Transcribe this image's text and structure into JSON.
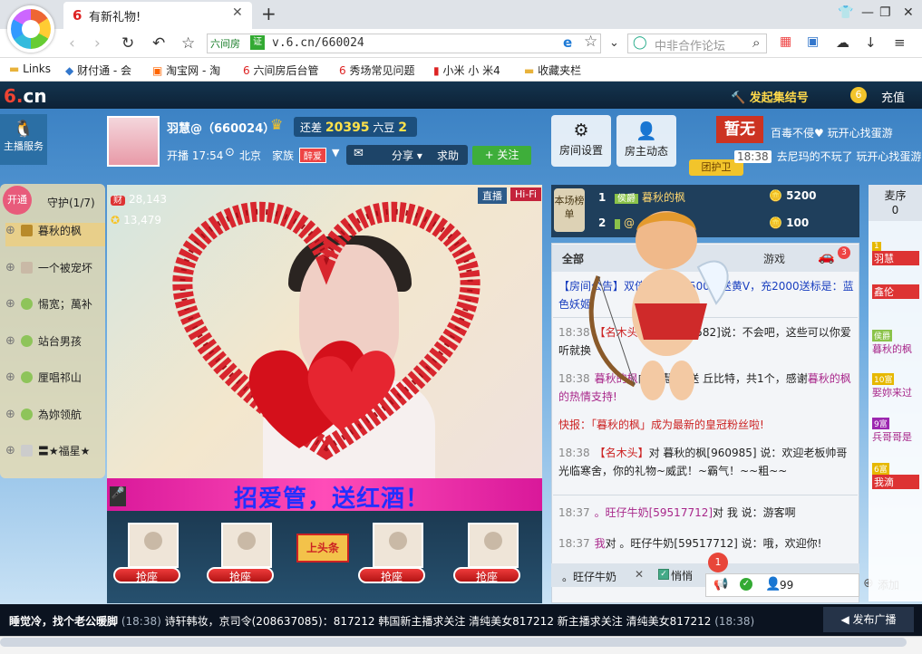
{
  "browser": {
    "tab_title": "有新礼物!",
    "tab_favicon": "6",
    "new_tab": "+",
    "address_badge": "六间房",
    "address_cert": "证",
    "url": "v.6.cn/660024",
    "search_placeholder": "中非合作论坛",
    "bookmarks": [
      "Links",
      "财付通 - 会",
      "淘宝网 - 淘",
      "六间房后台管",
      "秀场常见问题",
      "小米 小 米4",
      "收藏夹栏"
    ]
  },
  "site": {
    "logo_main": "6.",
    "logo_sub": "cn",
    "create_knot": "发起集结号",
    "coin_icon": "6",
    "recharge": "充值",
    "host_service": "主播服务"
  },
  "anchor": {
    "name": "羽慧@（660024）",
    "gap_label": "还差",
    "gap_value": "20395",
    "gap_next": "六豆",
    "gap_next_count": "2",
    "live_meta": "开播 17:54",
    "city": "北京",
    "family_label": "家族",
    "family_tag": "醉爱",
    "share": "分享",
    "help": "求助",
    "follow": "+ 关注",
    "wealth": "28,143",
    "wealth_icon": "财",
    "stars": "13,479"
  },
  "room_controls": {
    "settings": "房间设置",
    "dynamics": "房主动态"
  },
  "side_badges": {
    "none_badge": "暂无",
    "guard_group": "团护卫",
    "chat1": "百毒不侵♥ 玩开心找蛋游",
    "chat2_time": "18:38",
    "chat2": "去尼玛的不玩了 玩开心找蛋游"
  },
  "guard_list": {
    "open": "开通",
    "title": "守护(1/7)",
    "items": [
      {
        "name": "暮秋的枫"
      },
      {
        "name": "一个被宠坏"
      },
      {
        "name": "惕宽；萬补"
      },
      {
        "name": "站台男孩"
      },
      {
        "name": "厘唱祁山"
      },
      {
        "name": "為妳领航"
      },
      {
        "name": "〓★福星★"
      }
    ]
  },
  "video": {
    "live_tag": "直播",
    "hifi_tag": "Hi-Fi",
    "banner": "招爱管，送红酒！"
  },
  "seats": {
    "label": "抢座",
    "headline": "上头条"
  },
  "rank": {
    "label": "本场榜单",
    "rows": [
      {
        "rank": "1",
        "level": "侯爵",
        "name": "暮秋的枫",
        "coins": "5200"
      },
      {
        "rank": "2",
        "level": "",
        "name": "@",
        "coins": "100"
      }
    ]
  },
  "chat": {
    "tabs": [
      "全部",
      "游戏"
    ],
    "car_badge": "3",
    "messages": [
      {
        "time": "",
        "text": "【房间公告】双倍返点！充500块送黄V，充2000送",
        "tail": "标是：蓝色妖姬"
      },
      {
        "time": "18:38",
        "from": "【名木头】",
        "mid": "羽慧[960582]说：不会吧，这些可以",
        "tail": "你爱听就换"
      },
      {
        "time": "18:38",
        "from": "暮秋的枫",
        "mid": "向 羽慧@ 送 丘比特，共1个，感谢",
        "tail": "暮秋的枫 的热情支持!"
      },
      {
        "time": "",
        "text": "快报：「暮秋的枫」成为最新的皇冠粉丝啦!"
      },
      {
        "time": "18:38",
        "from": "【名木头】",
        "mid": "对 暮秋的枫[960985] 说：欢迎老板帅哥光临寒舍，你的礼物~威武！~霸气！~~粗~~",
        "tail": ""
      },
      {
        "time": "18:37",
        "from": "。旺仔牛奶[59517712]",
        "mid": "对 我 说：游客啊",
        "tail": ""
      },
      {
        "time": "18:37",
        "from": "我",
        "mid": "对 。旺仔牛奶[59517712] 说：哦，欢迎你!",
        "tail": ""
      }
    ],
    "private_name": "。旺仔牛奶",
    "private_label": "悄悄",
    "notif_count": "1",
    "viewers": "99",
    "add": "添加"
  },
  "right_strip": {
    "tab_title": "麦序",
    "tab_count": "0",
    "items": [
      {
        "level": "1",
        "name": "羽慧"
      },
      {
        "level": "",
        "name": "鑫伦"
      },
      {
        "level": "侯爵",
        "name": "暮秋的枫"
      },
      {
        "level": "10富",
        "name": "娶妳来过"
      },
      {
        "level": "9富",
        "name": "兵哥哥是"
      },
      {
        "level": "6富",
        "name": "我滴"
      }
    ]
  },
  "ticker": {
    "text_a": "睡觉冷，找个老公暖脚",
    "time_a": "(18:38)",
    "text_b": "诗轩韩妆，京司令(208637085)：817212 韩国新主播求关注 清纯美女817212 新主播求关注 清纯美女817212",
    "time_b": "(18:38)",
    "broadcast": "发布广播"
  },
  "colors": {
    "header_bg": "#14344f",
    "accent_red": "#c32",
    "follow_green": "#3eae3a",
    "banner_pink": "#ff4cb8",
    "banner_text": "#2330ff"
  }
}
